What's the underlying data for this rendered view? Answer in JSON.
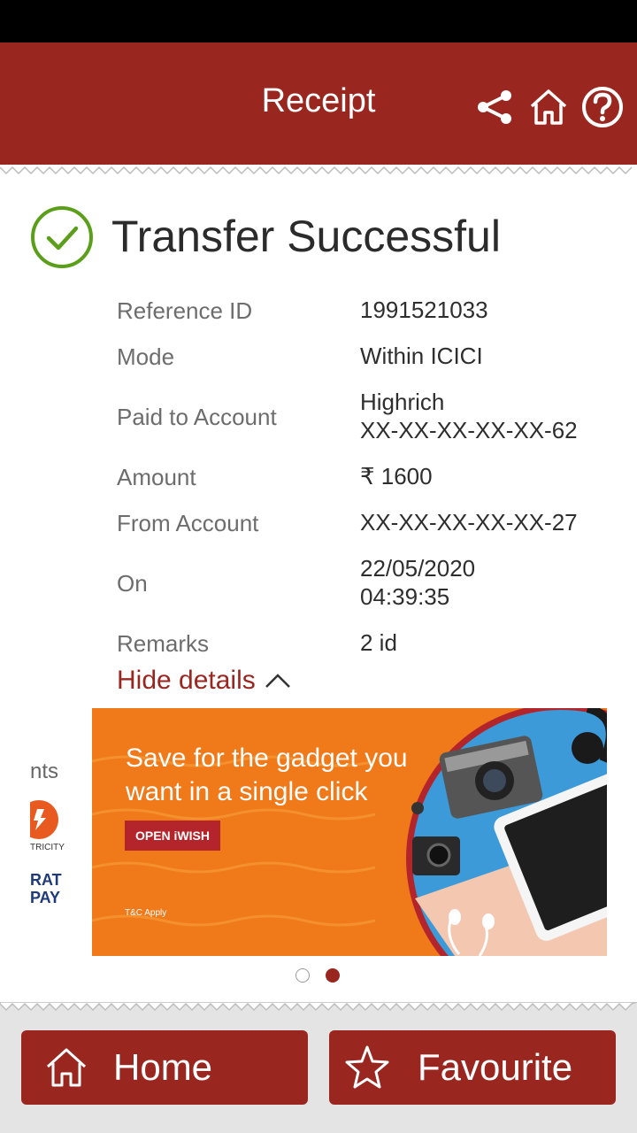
{
  "header": {
    "title": "Receipt",
    "icons": [
      "share-icon",
      "home-icon",
      "help-icon"
    ],
    "background_color": "#9a2620"
  },
  "status": {
    "title": "Transfer Successful",
    "icon": "check-circle-icon",
    "icon_color": "#5a9e1a"
  },
  "details": [
    {
      "label": "Reference ID",
      "value": "1991521033"
    },
    {
      "label": "Mode",
      "value": "Within ICICI"
    },
    {
      "label": "Paid to Account",
      "value": "Highrich\nXX-XX-XX-XX-XX-62"
    },
    {
      "label": "Amount",
      "value": "₹ 1600"
    },
    {
      "label": "From Account",
      "value": "XX-XX-XX-XX-XX-27"
    },
    {
      "label": "On",
      "value": "22/05/2020\n04:39:35"
    },
    {
      "label": "Remarks",
      "value": "2 id"
    }
  ],
  "hide_details": {
    "label": "Hide details",
    "icon": "chevron-up-icon"
  },
  "banner": {
    "line1": "Save for the gadget you",
    "line2": "want in a single click",
    "button": "OPEN iWISH",
    "tc": "T&C Apply",
    "left_peek": [
      "nts",
      "TRICITY",
      "RAT",
      "PAY"
    ],
    "accent_color": "#f07a1a"
  },
  "carousel": {
    "count": 2,
    "active": 2
  },
  "bottom": {
    "home_label": "Home",
    "favourite_label": "Favourite",
    "icons": [
      "home-icon",
      "star-icon"
    ]
  }
}
